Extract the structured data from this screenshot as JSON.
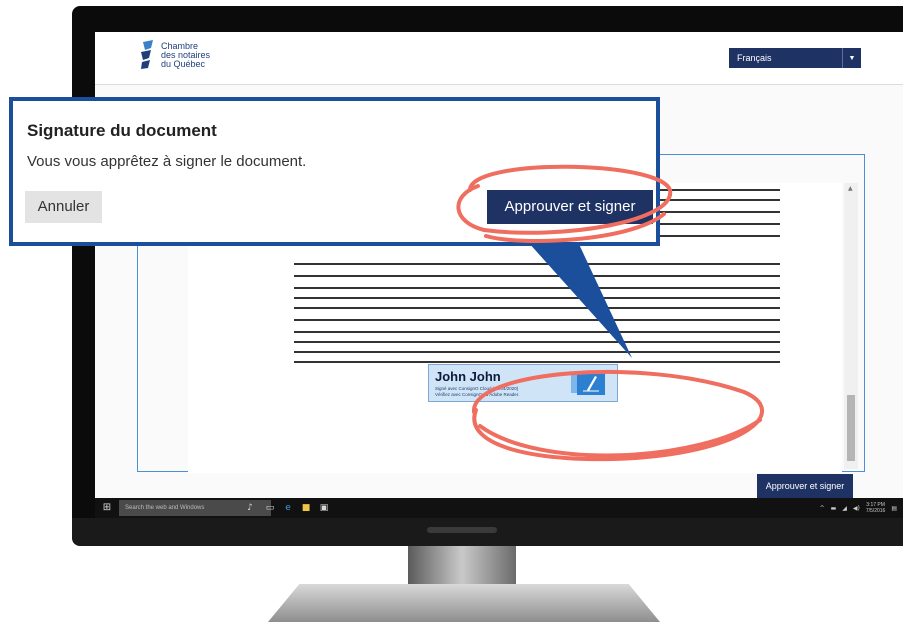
{
  "site": {
    "brand_lines": [
      "Chambre",
      "des notaires",
      "du Québec"
    ],
    "language": "Français"
  },
  "dialog": {
    "title": "Signature du document",
    "message": "Vous vous apprêtez à signer le document.",
    "cancel_label": "Annuler",
    "approve_label": "Approuver et signer"
  },
  "document": {
    "approve_label": "Approuver et signer",
    "signature": {
      "name": "John John",
      "line1": "Signé avec ConsignO Cloud (30/04/2020)",
      "line2": "Vérifiez avec ConsignO ou Adobe Reader."
    }
  },
  "taskbar": {
    "search_placeholder": "Search the web and Windows",
    "time": "3:17 PM",
    "date": "7/5/2016"
  },
  "colors": {
    "accent_navy": "#1f3264",
    "callout_border": "#1b4f9c",
    "highlight_ring": "#ef6e5f",
    "signature_bg": "#cfe4f7"
  }
}
